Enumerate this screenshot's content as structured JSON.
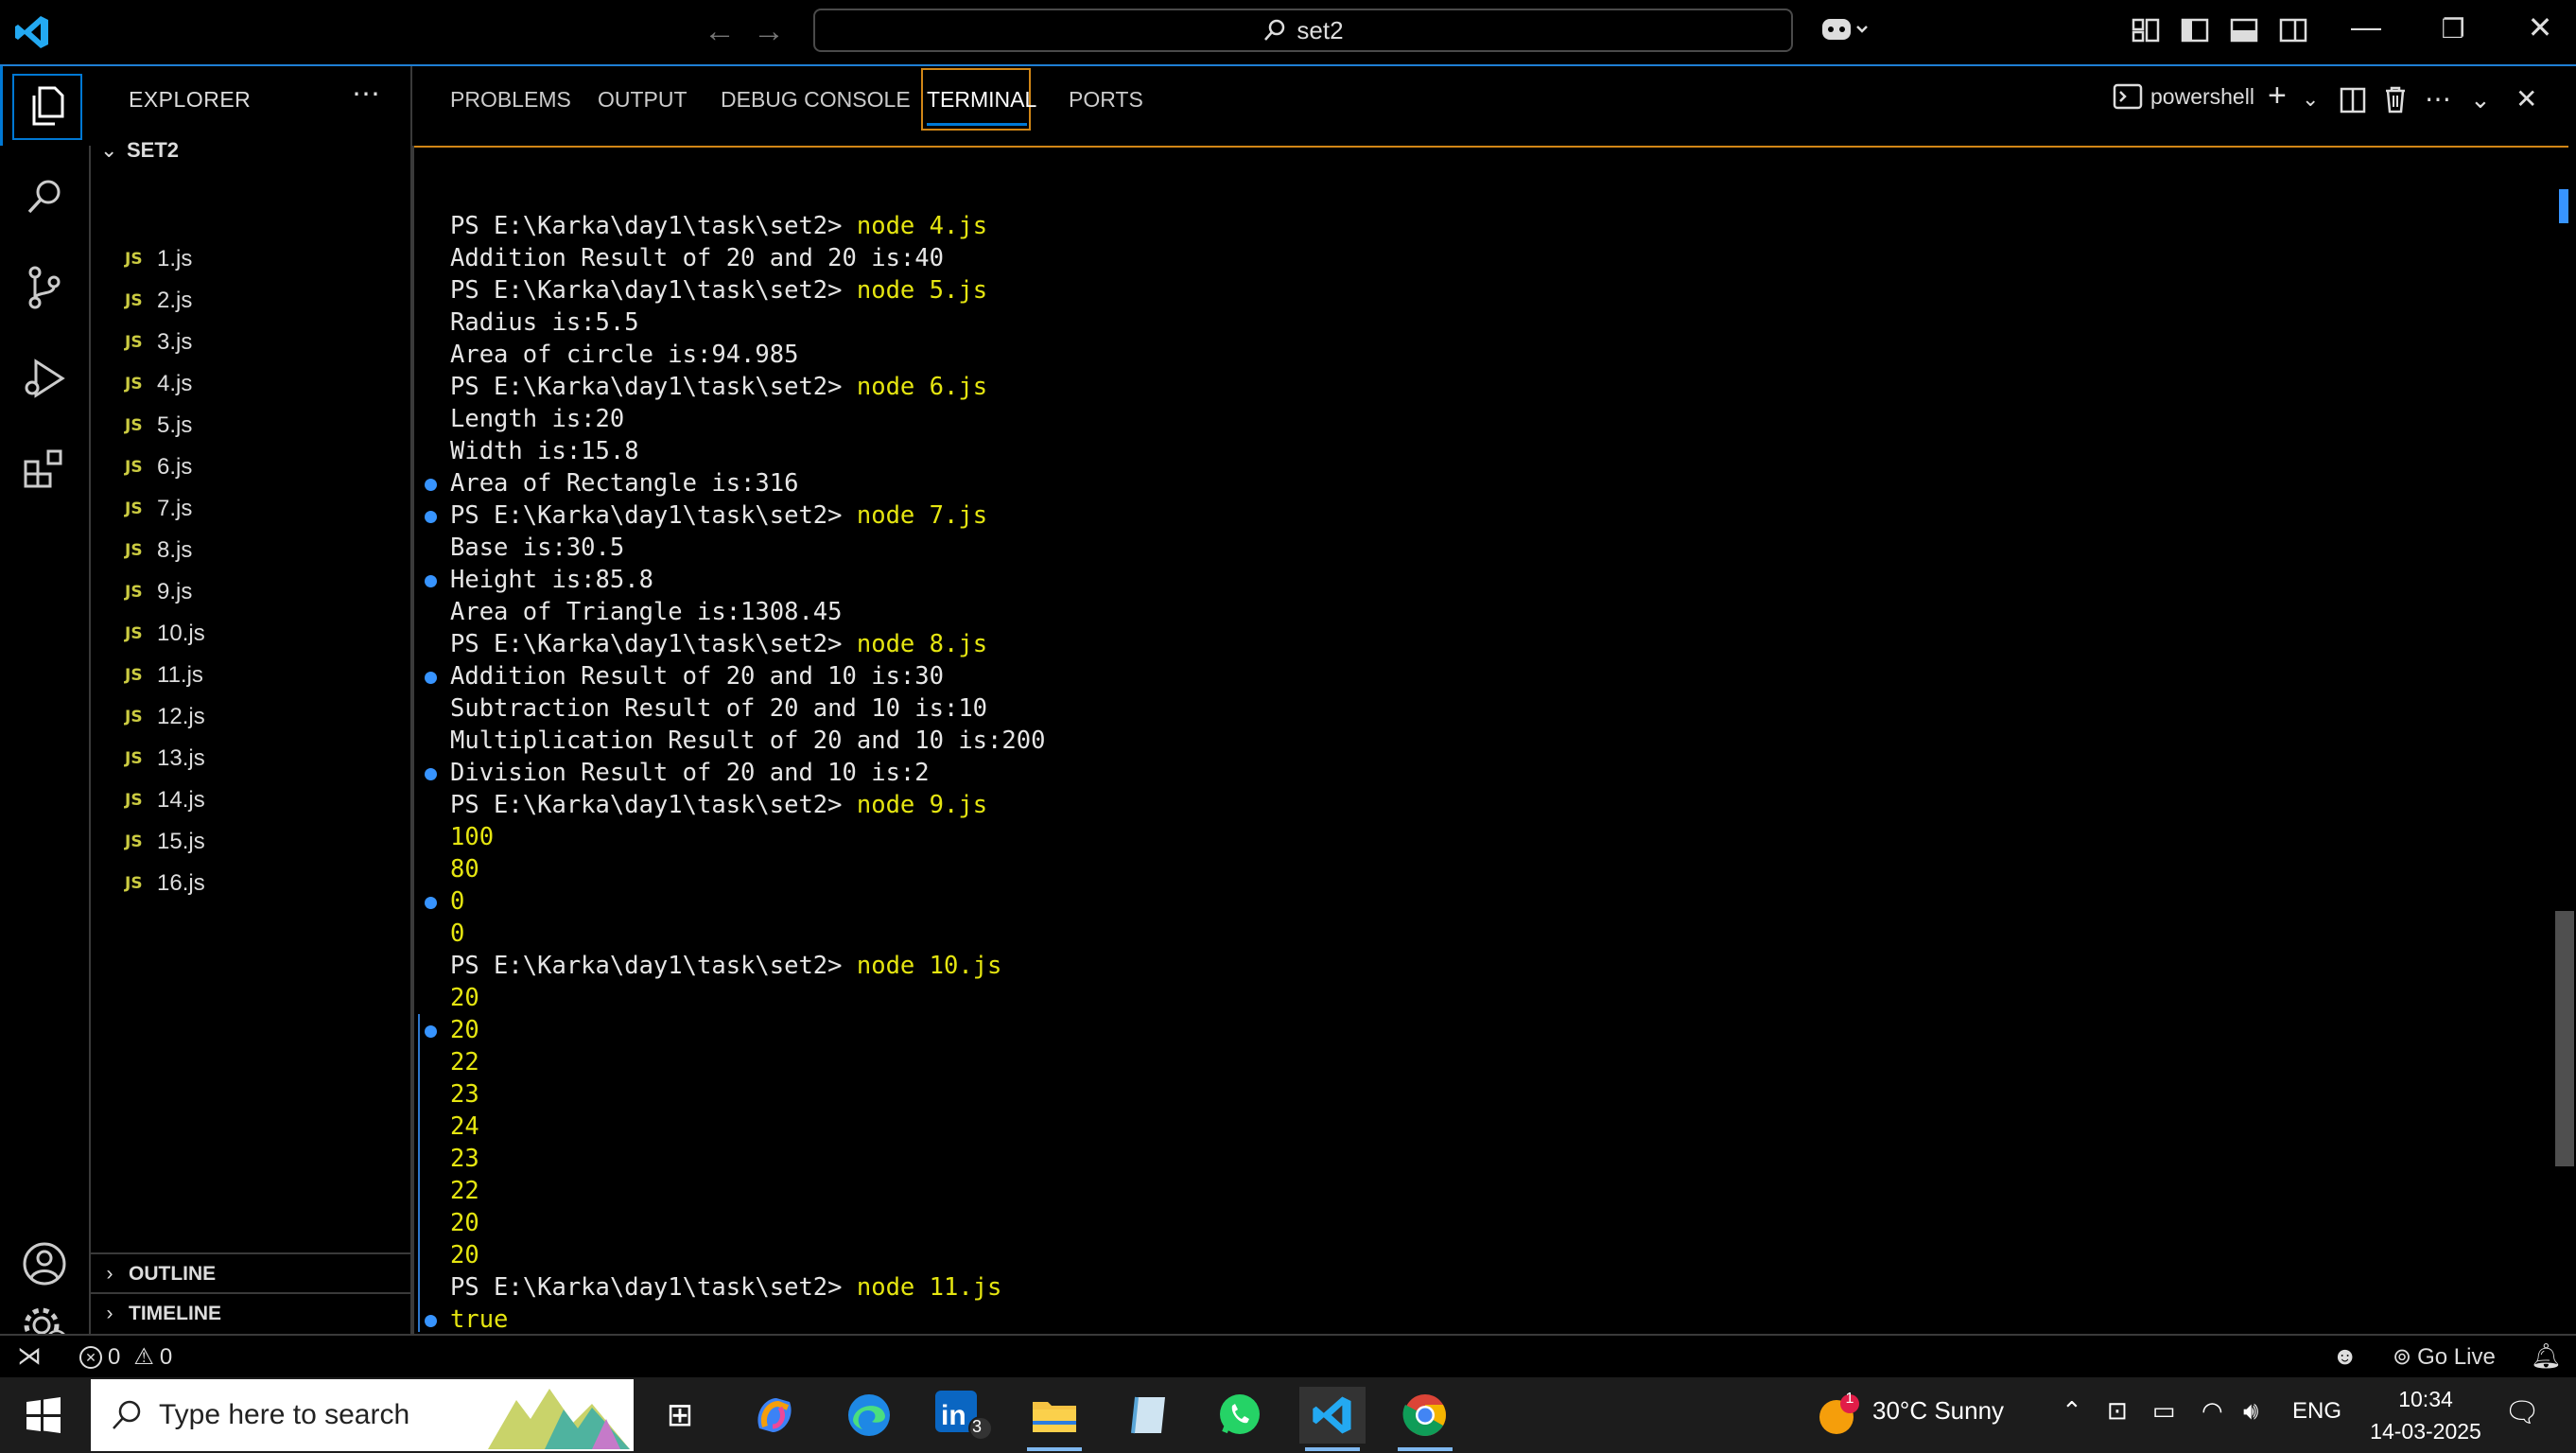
{
  "titlebar": {
    "search_text": "set2"
  },
  "sidebar": {
    "title": "EXPLORER",
    "folder": "SET2",
    "files": [
      "1.js",
      "2.js",
      "3.js",
      "4.js",
      "5.js",
      "6.js",
      "7.js",
      "8.js",
      "9.js",
      "10.js",
      "11.js",
      "12.js",
      "13.js",
      "14.js",
      "15.js",
      "16.js"
    ],
    "file_badge": "JS",
    "outline": "OUTLINE",
    "timeline": "TIMELINE"
  },
  "panel": {
    "tabs": [
      "PROBLEMS",
      "OUTPUT",
      "DEBUG CONSOLE",
      "TERMINAL",
      "PORTS"
    ],
    "active_tab": "TERMINAL",
    "shell": "powershell"
  },
  "terminal": {
    "prompt": "PS E:\\Karka\\day1\\task\\set2> ",
    "lines": [
      {
        "type": "cmd",
        "text": "node 4.js",
        "dot": false
      },
      {
        "type": "out",
        "text": "Addition Result of 20 and 20 is:40",
        "dot": false
      },
      {
        "type": "cmd",
        "text": "node 5.js",
        "dot": false
      },
      {
        "type": "out",
        "text": "Radius is:5.5",
        "dot": false
      },
      {
        "type": "out",
        "text": "Area of circle is:94.985",
        "dot": false
      },
      {
        "type": "cmd",
        "text": "node 6.js",
        "dot": false
      },
      {
        "type": "out",
        "text": "Length is:20",
        "dot": false
      },
      {
        "type": "out",
        "text": "Width is:15.8",
        "dot": false
      },
      {
        "type": "out",
        "text": "Area of Rectangle is:316",
        "dot": true
      },
      {
        "type": "cmd",
        "text": "node 7.js",
        "dot": true
      },
      {
        "type": "out",
        "text": "Base is:30.5",
        "dot": false
      },
      {
        "type": "out",
        "text": "Height is:85.8",
        "dot": true
      },
      {
        "type": "out",
        "text": "Area of Triangle is:1308.45",
        "dot": false
      },
      {
        "type": "cmd",
        "text": "node 8.js",
        "dot": false
      },
      {
        "type": "out",
        "text": "Addition Result of 20 and 10 is:30",
        "dot": true
      },
      {
        "type": "out",
        "text": "Subtraction Result of 20 and 10 is:10",
        "dot": false
      },
      {
        "type": "out",
        "text": "Multiplication Result of 20 and 10 is:200",
        "dot": false
      },
      {
        "type": "out",
        "text": "Division Result of 20 and 10 is:2",
        "dot": true
      },
      {
        "type": "cmd",
        "text": "node 9.js",
        "dot": false
      },
      {
        "type": "num",
        "text": "100",
        "dot": false
      },
      {
        "type": "num",
        "text": "80",
        "dot": false
      },
      {
        "type": "num",
        "text": "0",
        "dot": true
      },
      {
        "type": "num",
        "text": "0",
        "dot": false
      },
      {
        "type": "cmd",
        "text": "node 10.js",
        "dot": false
      },
      {
        "type": "num",
        "text": "20",
        "dot": false
      },
      {
        "type": "num",
        "text": "20",
        "dot": true
      },
      {
        "type": "num",
        "text": "22",
        "dot": false
      },
      {
        "type": "num",
        "text": "23",
        "dot": false
      },
      {
        "type": "num",
        "text": "24",
        "dot": false
      },
      {
        "type": "num",
        "text": "23",
        "dot": false
      },
      {
        "type": "num",
        "text": "22",
        "dot": false
      },
      {
        "type": "num",
        "text": "20",
        "dot": false
      },
      {
        "type": "num",
        "text": "20",
        "dot": false
      },
      {
        "type": "cmd",
        "text": "node 11.js",
        "dot": false
      },
      {
        "type": "num",
        "text": "true",
        "dot": true
      }
    ]
  },
  "statusbar": {
    "errors": "0",
    "warnings": "0",
    "go_live": "Go Live"
  },
  "taskbar": {
    "search_placeholder": "Type here to search",
    "linkedin_badge": "3",
    "weather_badge": "1",
    "weather": "30°C  Sunny",
    "lang": "ENG",
    "time": "10:34",
    "date": "14-03-2025"
  },
  "colors": {
    "accent": "#0078d4",
    "active_tab_border": "#d18616",
    "terminal_yellow": "#e5e510",
    "js_badge": "#cbcb41"
  }
}
